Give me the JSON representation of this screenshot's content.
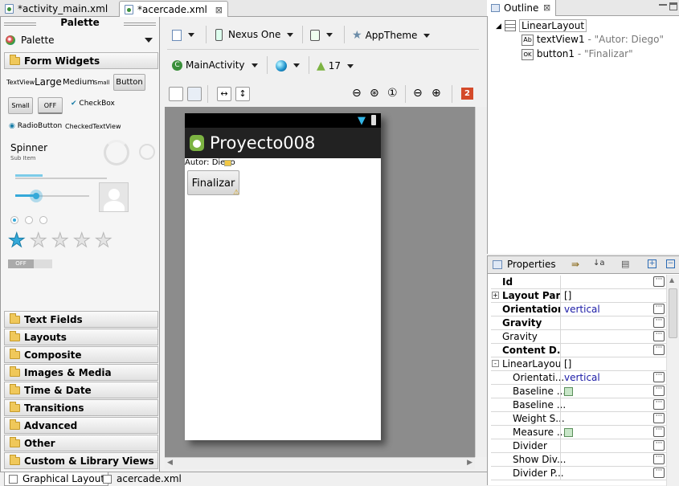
{
  "editor_tabs": [
    {
      "label": "*activity_main.xml",
      "active": false
    },
    {
      "label": "*acercade.xml",
      "active": true
    }
  ],
  "palette": {
    "title": "Palette",
    "dropdown_label": "Palette",
    "form_widgets_label": "Form Widgets",
    "widgets": {
      "textview": "TextView",
      "large": "Large",
      "medium": "Medium",
      "small": "Small",
      "button": "Button",
      "small_button": "Small",
      "off_toggle": "OFF",
      "checkbox": "CheckBox",
      "radiobutton": "RadioButton",
      "checkedtextview": "CheckedTextView",
      "spinner": "Spinner",
      "spinner_sub": "Sub Item",
      "switch_off": "OFF"
    },
    "categories": [
      "Text Fields",
      "Layouts",
      "Composite",
      "Images & Media",
      "Time & Date",
      "Transitions",
      "Advanced",
      "Other",
      "Custom & Library Views"
    ]
  },
  "toolbar": {
    "device": "Nexus One",
    "theme": "AppTheme",
    "activity": "MainActivity",
    "api": "17",
    "error_count": "2"
  },
  "preview": {
    "app_title": "Proyecto008",
    "text_view": "Autor: Diego",
    "button": "Finalizar"
  },
  "bottom_tabs": [
    {
      "label": "Graphical Layout",
      "active": true
    },
    {
      "label": "acercade.xml",
      "active": false
    }
  ],
  "outline": {
    "tab_label": "Outline",
    "root": "LinearLayout",
    "children": [
      {
        "id": "textView1",
        "value": " - \"Autor: Diego\""
      },
      {
        "id": "button1",
        "value": " - \"Finalizar\""
      }
    ]
  },
  "properties": {
    "tab_label": "Properties",
    "rows": [
      {
        "name": "Id",
        "value": "",
        "bold": true,
        "expand": ""
      },
      {
        "name": "Layout Par...",
        "value": "[]",
        "bold": true,
        "expand": "+"
      },
      {
        "name": "Orientation",
        "value": "vertical",
        "bold": true,
        "expand": ""
      },
      {
        "name": "Gravity",
        "value": "",
        "bold": true,
        "expand": ""
      },
      {
        "name": "Gravity",
        "value": "",
        "bold": false,
        "expand": ""
      },
      {
        "name": "Content D...",
        "value": "",
        "bold": true,
        "expand": ""
      },
      {
        "name": "LinearLayout",
        "value": "[]",
        "bold": false,
        "expand": "-"
      },
      {
        "name": "Orientati...",
        "value": "vertical",
        "bold": false,
        "expand": ""
      },
      {
        "name": "Baseline ...",
        "value": "",
        "bold": false,
        "expand": ""
      },
      {
        "name": "Baseline ...",
        "value": "",
        "bold": false,
        "expand": ""
      },
      {
        "name": "Weight S...",
        "value": "",
        "bold": false,
        "expand": ""
      },
      {
        "name": "Measure ...",
        "value": "",
        "bold": false,
        "expand": ""
      },
      {
        "name": "Divider",
        "value": "",
        "bold": false,
        "expand": ""
      },
      {
        "name": "Show Div...",
        "value": "",
        "bold": false,
        "expand": ""
      },
      {
        "name": "Divider P...",
        "value": "",
        "bold": false,
        "expand": ""
      }
    ]
  }
}
